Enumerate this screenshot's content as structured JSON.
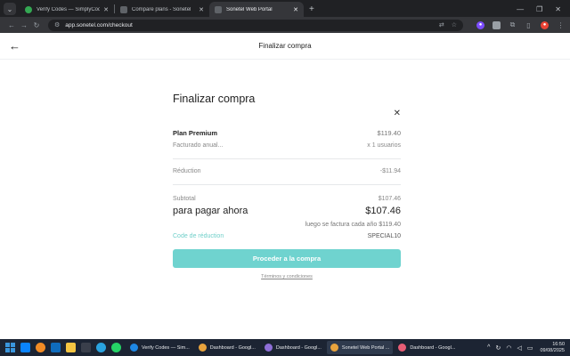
{
  "browser": {
    "tabs": [
      {
        "label": "Verify Codes — SimplyCodes",
        "active": false
      },
      {
        "label": "Compare plans - Sonetel",
        "active": false
      },
      {
        "label": "Sonetel Web Portal",
        "active": true
      }
    ],
    "url": "app.sonetel.com/checkout",
    "colors": {
      "tab_bar": "#202124",
      "toolbar": "#35363a"
    }
  },
  "header": {
    "title": "Finalizar compra"
  },
  "checkout": {
    "title": "Finalizar compra",
    "plan_name": "Plan Premium",
    "plan_price": "$119.40",
    "billing_label": "Facturado anual...",
    "users_label": "x 1 usuarios",
    "reduction_label": "Réduction",
    "reduction_value": "-$11.94",
    "subtotal_label": "Subtotal",
    "subtotal_value": "$107.46",
    "pay_now_label": "para pagar ahora",
    "pay_now_value": "$107.46",
    "billed_yearly": "luego se factura cada año $119.40",
    "code_label": "Code de réduction",
    "code_value": "SPECIAL10",
    "proceed_label": "Proceder a la compra",
    "terms_label": "Términos y condiciones",
    "accent_color": "#6fd3cf"
  },
  "taskbar": {
    "apps": [
      {
        "label": "Verify Codes — Sim...",
        "active": false
      },
      {
        "label": "Dashboard - Googl...",
        "active": false
      },
      {
        "label": "Dashboard - Googl...",
        "active": false
      },
      {
        "label": "Sonetel Web Portal ...",
        "active": true
      },
      {
        "label": "Dashboard - Googl...",
        "active": false
      }
    ],
    "time": "16:50",
    "date": "09/08/2025"
  }
}
